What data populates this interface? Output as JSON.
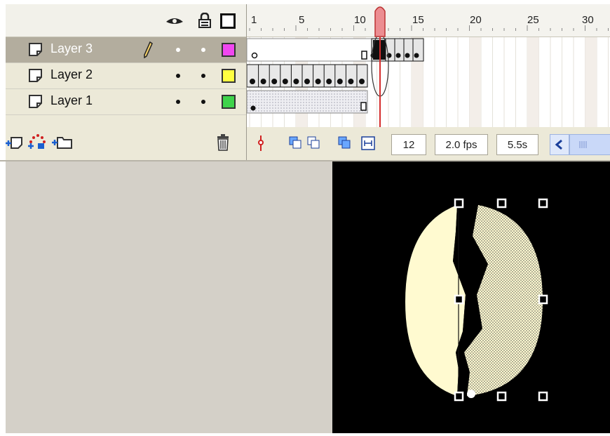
{
  "timeline": {
    "column_icons": [
      "eye-icon",
      "lock-icon",
      "outline-icon"
    ],
    "layers": [
      {
        "name": "Layer 3",
        "selected": true,
        "color": "#f047f0",
        "pencil": true
      },
      {
        "name": "Layer 2",
        "selected": false,
        "color": "#ffff40"
      },
      {
        "name": "Layer 1",
        "selected": false,
        "color": "#3fd34b"
      }
    ],
    "ruler_labels": [
      "1",
      "5",
      "10",
      "15",
      "20",
      "25",
      "30"
    ],
    "current_frame": "12",
    "frame_rate": "2.0 fps",
    "elapsed_time": "5.5s"
  },
  "colors": {
    "stage": "#000000",
    "pasteboard": "#d4d0c8",
    "shape_fill": "#fffad0",
    "playhead": "#e46f73",
    "selection_handles": "#ffffff"
  }
}
